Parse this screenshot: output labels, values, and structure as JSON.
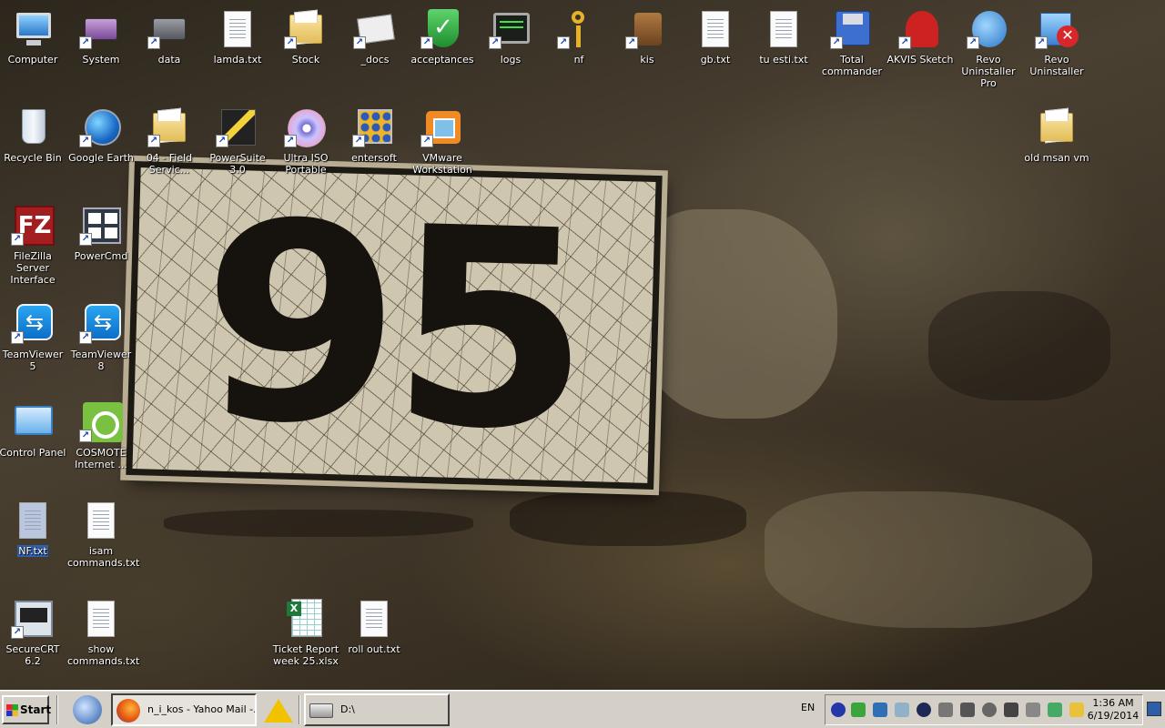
{
  "desktop": {
    "wallpaper_number": "95",
    "icons": {
      "computer": "Computer",
      "system": "System",
      "data": "data",
      "lamda": "lamda.txt",
      "stock": "Stock",
      "docs": "_docs",
      "acceptances": "acceptances",
      "logs": "logs",
      "nf": "nf",
      "kis": "kis",
      "gb": "gb.txt",
      "tuesti": "tu esti.txt",
      "totalcmd": "Total commander",
      "akvis": "AKVIS Sketch",
      "revopro": "Revo Uninstaller Pro",
      "revo": "Revo Uninstaller",
      "recycle": "Recycle Bin",
      "gearth": "Google Earth",
      "field": "04 - Field Servic...",
      "powersuite": "PowerSuite 3.0",
      "ultraiso": "Ultra ISO Portable",
      "entersoft": "entersoft",
      "vmware": "VMware Workstation",
      "oldmsan": "old msan vm",
      "filezilla": "FileZilla Server Interface",
      "powercmd": "PowerCmd",
      "tv5": "TeamViewer 5",
      "tv8": "TeamViewer 8",
      "cpanel": "Control Panel",
      "cosmote": "COSMOTE Internet ...",
      "nftxt": "NF.txt",
      "isam": "isam commands.txt",
      "securecrt": "SecureCRT 6.2",
      "show": "show commands.txt",
      "ticket": "Ticket Report week 25.xlsx",
      "rollout": "roll out.txt"
    }
  },
  "taskbar": {
    "start_label": "Start",
    "firefox_window": "n_i_kos - Yahoo Mail -...",
    "explorer_window": "D:\\",
    "language": "EN",
    "clock_time": "1:36 AM",
    "clock_date": "6/19/2014"
  }
}
